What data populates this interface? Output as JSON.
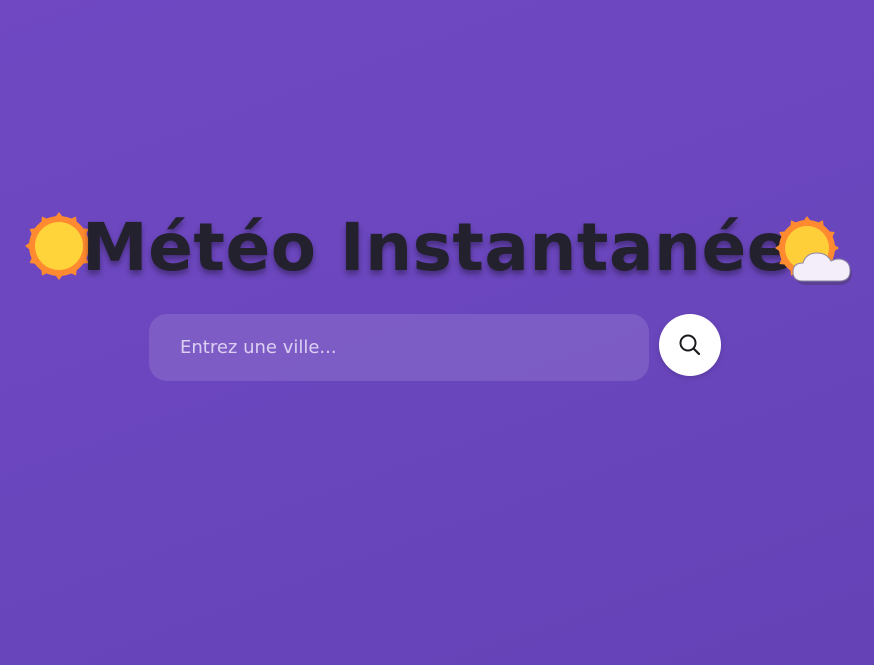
{
  "header": {
    "title": "Météo Instantanée",
    "left_icon": "sun-icon",
    "right_icon": "sun-behind-cloud-icon"
  },
  "search": {
    "placeholder": "Entrez une ville...",
    "value": "",
    "button_icon": "search-icon"
  },
  "colors": {
    "background": "#6b47be",
    "title": "#24212e",
    "sun_core": "#ffd43b",
    "sun_rays": "#ff8a30",
    "cloud": "#f3eef9",
    "button": "#ffffff"
  }
}
